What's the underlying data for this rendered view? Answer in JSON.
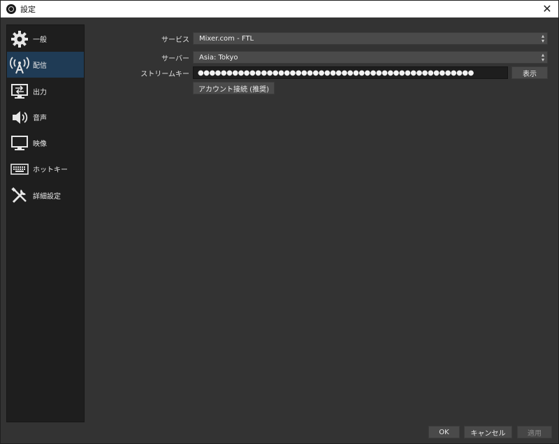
{
  "window": {
    "title": "設定",
    "close_glyph": "✕"
  },
  "sidebar": {
    "items": [
      {
        "label": "一般",
        "icon": "gear-icon"
      },
      {
        "label": "配信",
        "icon": "broadcast-antenna-icon",
        "active": true
      },
      {
        "label": "出力",
        "icon": "output-monitor-icon"
      },
      {
        "label": "音声",
        "icon": "speaker-icon"
      },
      {
        "label": "映像",
        "icon": "monitor-icon"
      },
      {
        "label": "ホットキー",
        "icon": "keyboard-icon"
      },
      {
        "label": "詳細設定",
        "icon": "tools-icon"
      }
    ]
  },
  "stream": {
    "service_label": "サービス",
    "service_value": "Mixer.com - FTL",
    "server_label": "サーバー",
    "server_value": "Asia: Tokyo",
    "key_label": "ストリームキー",
    "key_value": "●●●●●●●●●●●●●●●●●●●●●●●●●●●●●●●●●●●●●●●●●●●●●●●●",
    "show_button": "表示",
    "connect_button": "アカウント接続 (推奨)"
  },
  "footer": {
    "ok": "OK",
    "cancel": "キャンセル",
    "apply": "適用"
  },
  "colors": {
    "accent_active": "#1f3b55",
    "background": "#333333",
    "sidebar": "#1e1e1e"
  }
}
